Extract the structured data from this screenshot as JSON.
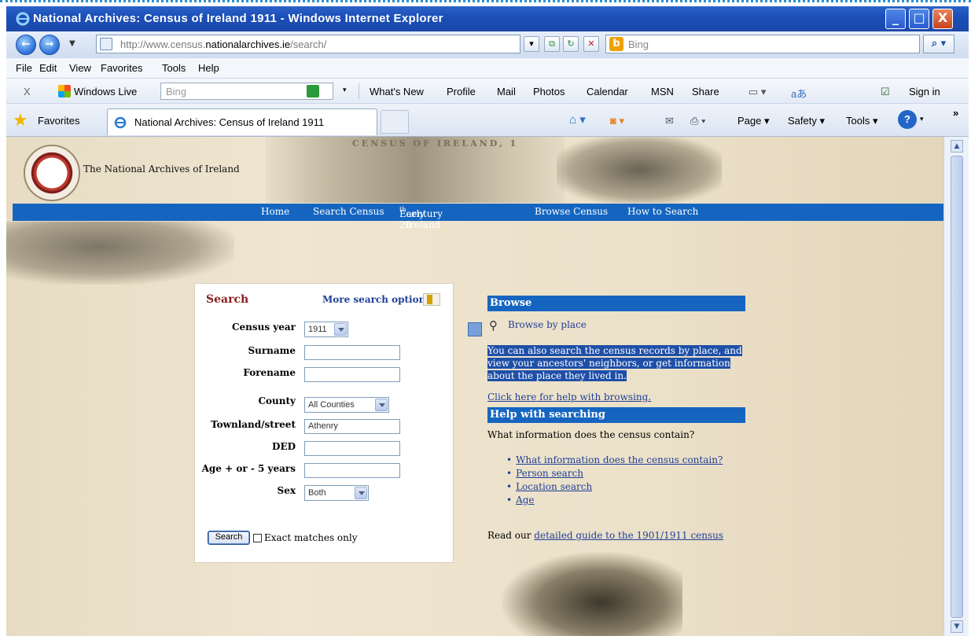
{
  "window": {
    "title": "National Archives: Census of Ireland 1911 - Windows Internet Explorer",
    "minimize": "_",
    "maximize": "□",
    "close": "X"
  },
  "address_bar": {
    "url_prefix": "http://www.census.",
    "url_domain": "nationalarchives.ie",
    "url_suffix": "/search/",
    "search_placeholder": "Bing",
    "search_go": "⌕ ▾"
  },
  "menu": [
    "File",
    "Edit",
    "View",
    "Favorites",
    "Tools",
    "Help"
  ],
  "live_toolbar": {
    "close": "X",
    "label": "Windows Live",
    "search_placeholder": "Bing",
    "dropdown": "▾",
    "links": [
      "What's New",
      "Profile",
      "Mail",
      "Photos",
      "Calendar",
      "MSN",
      "Share"
    ],
    "sign_in": "Sign in"
  },
  "favorites_bar": {
    "favorites_label": "Favorites",
    "tab_title": "National Archives: Census of Ireland 1911",
    "commands": [
      "Page ▾",
      "Safety ▾",
      "Tools ▾"
    ],
    "overflow": "»"
  },
  "site": {
    "logo_text": "The National Archives of Ireland",
    "banner": "CENSUS OF IRELAND, 1",
    "nav": [
      "Home",
      "Search Census",
      "Early 20",
      "th",
      " century Ireland",
      "Browse Census",
      "How to Search"
    ]
  },
  "search_form": {
    "title": "Search",
    "more_options": "More search options",
    "fields": {
      "census_year_label": "Census year",
      "census_year_value": "1911",
      "surname_label": "Surname",
      "surname_value": "",
      "forename_label": "Forename",
      "forename_value": "",
      "county_label": "County",
      "county_value": "All Counties",
      "townland_label": "Townland/street",
      "townland_value": "Athenry",
      "ded_label": "DED",
      "ded_value": "",
      "age_label": "Age + or - 5 years",
      "age_value": "",
      "sex_label": "Sex",
      "sex_value": "Both"
    },
    "search_button": "Search",
    "exact_matches_label": "Exact matches only"
  },
  "browse": {
    "heading": "Browse",
    "browse_by_place": "Browse by place",
    "description": "You can also search the census records by place, and view your ancestors' neighbors, or get information about the place they lived in.",
    "help_link": "Click here for help with browsing."
  },
  "help": {
    "heading": "Help with searching",
    "question": "What information does the census contain?",
    "links": [
      "What information does the census contain?",
      "Person search",
      "Location search",
      "Age"
    ],
    "guide_prefix": "Read our ",
    "guide_link": "detailed guide to the 1901/1911 census"
  }
}
